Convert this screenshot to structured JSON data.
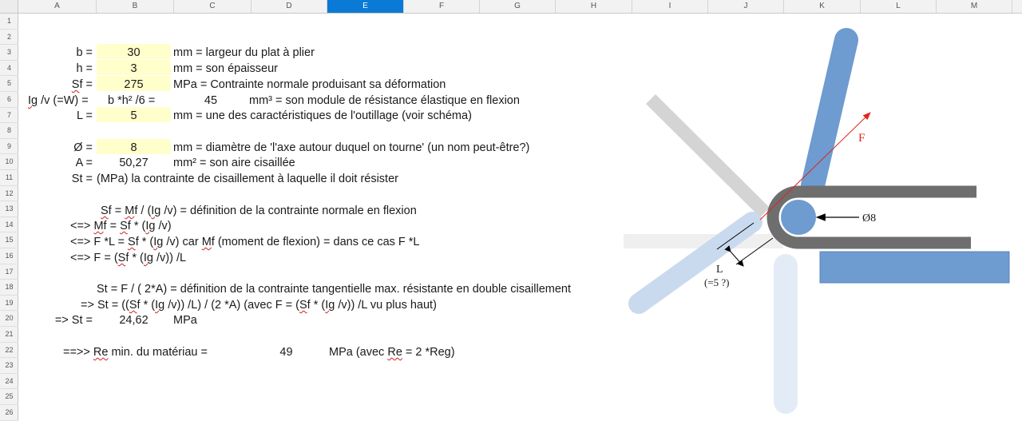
{
  "sheet": {
    "columns": [
      "A",
      "B",
      "C",
      "D",
      "E",
      "F",
      "G",
      "H",
      "I",
      "J",
      "K",
      "L",
      "M"
    ],
    "selected_column": "E",
    "rows": [
      "1",
      "2",
      "3",
      "4",
      "5",
      "6",
      "7",
      "8",
      "9",
      "10",
      "11",
      "12",
      "13",
      "14",
      "15",
      "16",
      "17",
      "18",
      "19",
      "20",
      "21",
      "22",
      "23",
      "24",
      "25",
      "26"
    ]
  },
  "cells": {
    "r3": {
      "label": "b =",
      "value": "30",
      "desc": "mm = largeur du plat à plier"
    },
    "r4": {
      "label": "h =",
      "value": "3",
      "desc": "mm = son épaisseur"
    },
    "r5": {
      "label_a": "S",
      "label_b": "f =",
      "value": "275",
      "desc": "MPa = Contrainte normale produisant sa déformation"
    },
    "r6": {
      "label_a": "Ig",
      "label_b": " /v (=W) =",
      "formula": "b *h² /6 =",
      "value": "45",
      "desc": "mm³ = son module de résistance élastique en flexion"
    },
    "r7": {
      "label": "L =",
      "value": "5",
      "desc": "mm = une des caractéristiques de l'outillage (voir schéma)"
    },
    "r9": {
      "label": "Ø =",
      "value": "8",
      "desc": "mm = diamètre de 'l'axe autour duquel on tourne' (un nom peut-être?)"
    },
    "r10": {
      "label": "A =",
      "value": "50,27",
      "desc": "mm² = son aire cisaillée"
    },
    "r11": {
      "label": "St =",
      "desc": "(MPa) la contrainte de cisaillement à laquelle il doit résister"
    },
    "r13": [
      "S",
      "f = ",
      "M",
      "f",
      " / (",
      "Ig",
      " /v) = définition de la contrainte normale en flexion"
    ],
    "r14": [
      "<=> ",
      "M",
      "f = ",
      "S",
      "f * (",
      "Ig",
      " /v)"
    ],
    "r15": [
      "<=> F *L = ",
      "S",
      "f * (",
      "Ig",
      " /v)  car ",
      "M",
      "f (moment de flexion) = dans ce cas  F *L"
    ],
    "r16": [
      "<=> F = (",
      "S",
      "f * (",
      "Ig",
      " /v)) /L"
    ],
    "r18": "St = F / ( 2*A) = définition de la contrainte tangentielle max. résistante en double cisaillement",
    "r19": [
      "=> St = ((",
      "S",
      "f * (",
      "Ig",
      " /v)) /L) / (2 *A)  (avec F =  (",
      "S",
      "f * (",
      "Ig",
      " /v)) /L vu plus haut)"
    ],
    "r20": {
      "label": "=> St =",
      "value": "24,62",
      "unit": "MPa"
    },
    "r22": {
      "label_a": "==>> ",
      "label_b": "Re",
      "label_c": " min. du matériau =",
      "value": "49",
      "desc_a": "MPa (avec ",
      "desc_b": "Re",
      "desc_c": " = 2 *Reg)"
    }
  },
  "diagram": {
    "force_label": "F",
    "diameter_label": "Ø8",
    "l_label": "L",
    "l_note": "(=5 ?)",
    "colors": {
      "part": "#6e9bd0",
      "part_light": "#c9daee",
      "tool_dark": "#6e6e6e",
      "tool_light": "#d0d0d0",
      "arrow": "#e0251b"
    }
  }
}
